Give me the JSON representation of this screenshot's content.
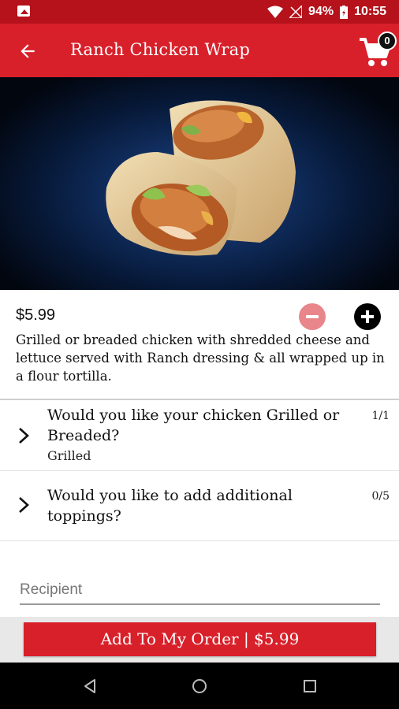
{
  "status_bar": {
    "battery_percent": "94%",
    "time": "10:55",
    "icons": [
      "gallery-icon",
      "wifi-icon",
      "no-signal-icon",
      "battery-icon"
    ]
  },
  "app_bar": {
    "title": "Ranch Chicken Wrap",
    "cart_count": "0",
    "icons": [
      "back-arrow-icon",
      "cart-icon"
    ]
  },
  "product": {
    "price": "$5.99",
    "description": "Grilled or breaded chicken with shredded cheese and lettuce served with Ranch dressing & all wrapped up in a flour tortilla."
  },
  "options": [
    {
      "question": "Would you like your chicken Grilled or Breaded?",
      "selected": "Grilled",
      "count": "1/1"
    },
    {
      "question": "Would you like to add additional toppings?",
      "selected": "",
      "count": "0/5"
    }
  ],
  "recipient": {
    "placeholder": "Recipient",
    "value": ""
  },
  "order_button": {
    "label": "Add To My Order | $5.99"
  },
  "colors": {
    "primary": "#d8202a",
    "status_bar": "#b5121b",
    "minus_disabled": "#e8868b"
  }
}
